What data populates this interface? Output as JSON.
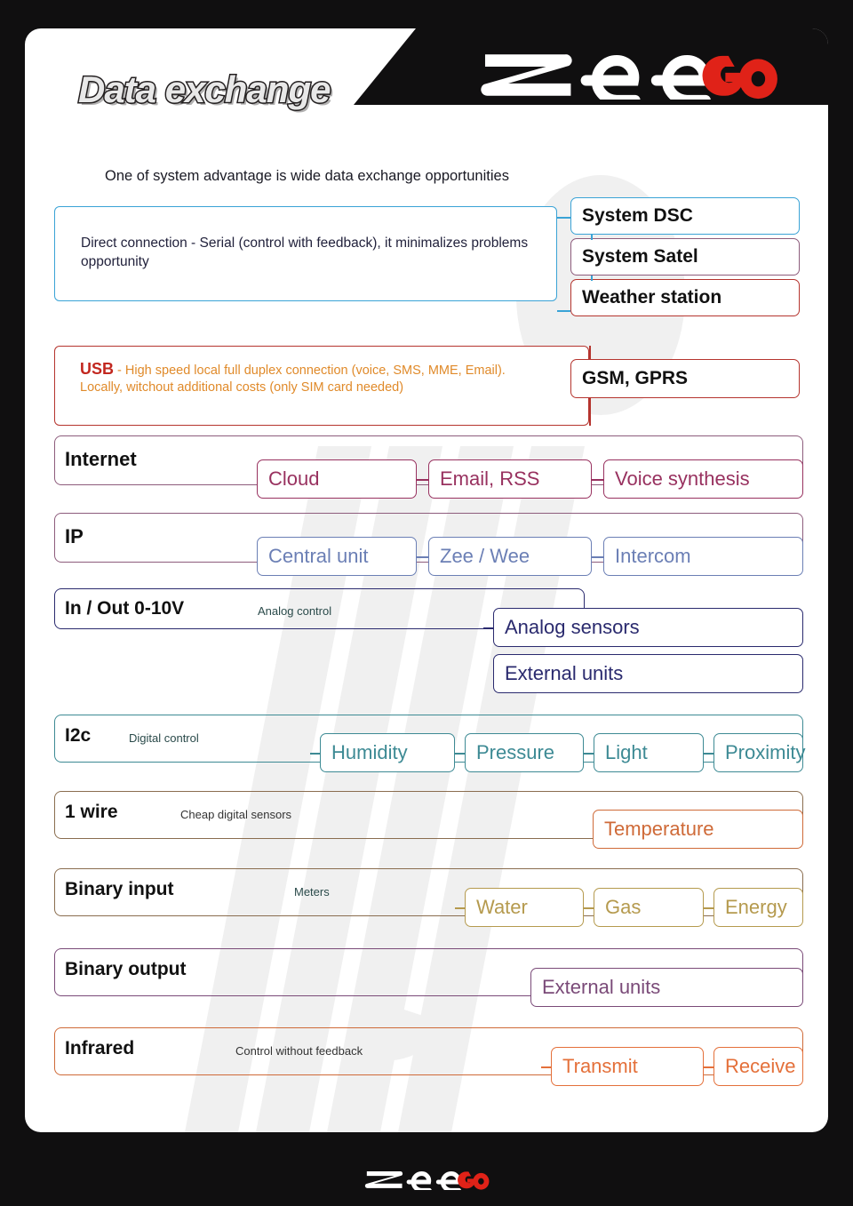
{
  "header": {
    "title": "Data exchange",
    "logo_main": "zee",
    "logo_accent": "GO",
    "subtitle": "One of system advantage is wide data exchange opportunities"
  },
  "footer": {
    "logo_main": "zee",
    "logo_accent": "GO"
  },
  "colors": {
    "blue": "#3aa3d6",
    "red": "#b5342e",
    "orange_text": "#e08a2a",
    "usb_red": "#c2271f",
    "dark_text": "#22223c",
    "plum": "#8d5c7c",
    "magenta": "#98315f",
    "slate_blue": "#6b7fb5",
    "navy": "#2a2a6e",
    "teal": "#3d8a94",
    "brown": "#8a6d4f",
    "orange_t": "#cf6a38",
    "gold": "#b59a4e",
    "purple": "#7a4a78",
    "orange_ir": "#e4703a",
    "gray_line": "#8a8a8a"
  },
  "notes": [
    {
      "id": "serial-note",
      "text": "Direct connection - Serial (control with feedback), it minimalizes problems opportunity"
    },
    {
      "id": "usb-note",
      "strong": "USB",
      "text": " - High speed local full duplex connection (voice, SMS, MME, Email). Locally, witchout additional costs (only SIM card needed)"
    }
  ],
  "top_targets": [
    {
      "label": "System DSC"
    },
    {
      "label": "System Satel"
    },
    {
      "label": "Weather station"
    },
    {
      "label": "GSM, GPRS"
    }
  ],
  "rows": [
    {
      "id": "internet",
      "label": "Internet",
      "sub": "",
      "items": [
        "Cloud",
        "Email, RSS",
        "Voice synthesis"
      ]
    },
    {
      "id": "ip",
      "label": "IP",
      "sub": "",
      "items": [
        "Central unit",
        "Zee / Wee",
        "Intercom"
      ]
    },
    {
      "id": "inout",
      "label": "In / Out 0-10V",
      "sub": "Analog control",
      "items": [
        "Analog sensors",
        "External units"
      ]
    },
    {
      "id": "i2c",
      "label": "I2c",
      "sub": "Digital control",
      "items": [
        "Humidity",
        "Pressure",
        "Light",
        "Proximity"
      ]
    },
    {
      "id": "onewire",
      "label": "1 wire",
      "sub": "Cheap digital sensors",
      "items": [
        "Temperature"
      ]
    },
    {
      "id": "binary-input",
      "label": "Binary input",
      "sub": "Meters",
      "items": [
        "Water",
        "Gas",
        "Energy"
      ]
    },
    {
      "id": "binary-output",
      "label": "Binary output",
      "sub": "",
      "items": [
        "External units"
      ]
    },
    {
      "id": "infrared",
      "label": "Infrared",
      "sub": "Control without feedback",
      "items": [
        "Transmit",
        "Receive"
      ]
    }
  ]
}
